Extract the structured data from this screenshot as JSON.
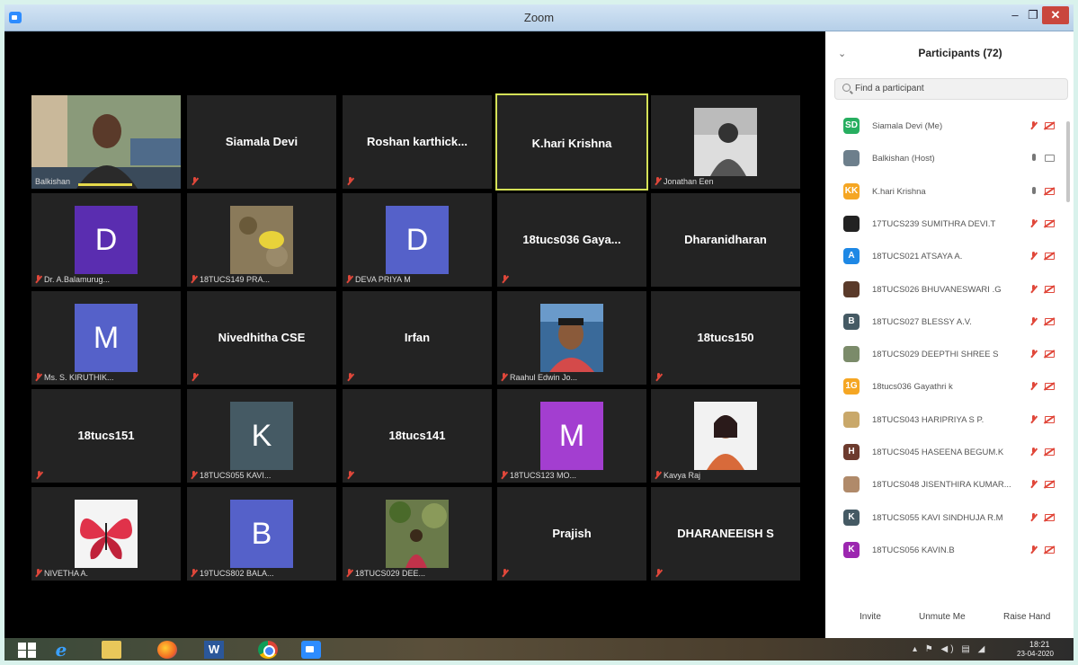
{
  "window": {
    "title": "Zoom",
    "min": "–",
    "max": "❐",
    "close": "✕"
  },
  "tiles": {
    "balkishan": "Balkishan",
    "siamala": "Siamala Devi",
    "roshan": "Roshan  karthick...",
    "khari": "K.hari Krishna",
    "jonathan": "Jonathan Een",
    "bala_label": "Dr. A.Balamurug...",
    "bala_letter": "D",
    "pra_label": "18TUCS149 PRA...",
    "deva_label": "DEVA PRIYA M",
    "deva_letter": "D",
    "gaya": "18tucs036 Gaya...",
    "dharanidharan": "Dharanidharan",
    "kiruthik_label": "Ms. S. KIRUTHIK...",
    "kiruthik_letter": "M",
    "nivedhitha": "Nivedhitha CSE",
    "irfan": "Irfan",
    "raahul_label": "Raahul Edwin Jo...",
    "t150": "18tucs150",
    "t151": "18tucs151",
    "kavi_label": "18TUCS055 KAVI...",
    "kavi_letter": "K",
    "t141": "18tucs141",
    "mo_label": "18TUCS123 MO...",
    "mo_letter": "M",
    "kavya_label": "Kavya Raj",
    "nivetha_label": "NIVETHA A.",
    "bala2_label": "19TUCS802 BALA...",
    "bala2_letter": "B",
    "dee_label": "18TUCS029 DEE...",
    "prajish": "Prajish",
    "dharaneeish": "DHARANEEISH S"
  },
  "panel": {
    "title": "Participants (72)",
    "collapse": "⌄",
    "search_placeholder": "Find a participant",
    "invite": "Invite",
    "unmute": "Unmute Me",
    "raise_hand": "Raise Hand",
    "participants": [
      {
        "initials": "SD",
        "name": "Siamala Devi (Me)",
        "color": "#27ae60"
      },
      {
        "initials": "",
        "name": "Balkishan (Host)",
        "color": "#6d7f8c"
      },
      {
        "initials": "KK",
        "name": "K.hari Krishna",
        "color": "#f5a623"
      },
      {
        "initials": "",
        "name": "17TUCS239 SUMITHRA DEVI.T",
        "color": "#222222"
      },
      {
        "initials": "A",
        "name": "18TUCS021 ATSAYA A.",
        "color": "#1e88e5"
      },
      {
        "initials": "",
        "name": "18TUCS026 BHUVANESWARI .G",
        "color": "#5a3a2a"
      },
      {
        "initials": "B",
        "name": "18TUCS027 BLESSY A.V.",
        "color": "#455a64"
      },
      {
        "initials": "",
        "name": "18TUCS029 DEEPTHI SHREE S",
        "color": "#7b8b6a"
      },
      {
        "initials": "1G",
        "name": "18tucs036 Gayathri k",
        "color": "#f5a623"
      },
      {
        "initials": "",
        "name": "18TUCS043 HARIPRIYA S P.",
        "color": "#c9a86a"
      },
      {
        "initials": "H",
        "name": "18TUCS045 HASEENA BEGUM.K",
        "color": "#6d3b2e"
      },
      {
        "initials": "",
        "name": "18TUCS048 JISENTHIRA KUMAR...",
        "color": "#b08a6a"
      },
      {
        "initials": "K",
        "name": "18TUCS055 KAVI SINDHUJA R.M",
        "color": "#455a64"
      },
      {
        "initials": "K",
        "name": "18TUCS056 KAVIN.B",
        "color": "#9c27b0"
      }
    ]
  },
  "taskbar": {
    "tray": "▴ ⚑ ◀) ▤ ◢",
    "time": "18:21",
    "date": "23-04-2020"
  }
}
